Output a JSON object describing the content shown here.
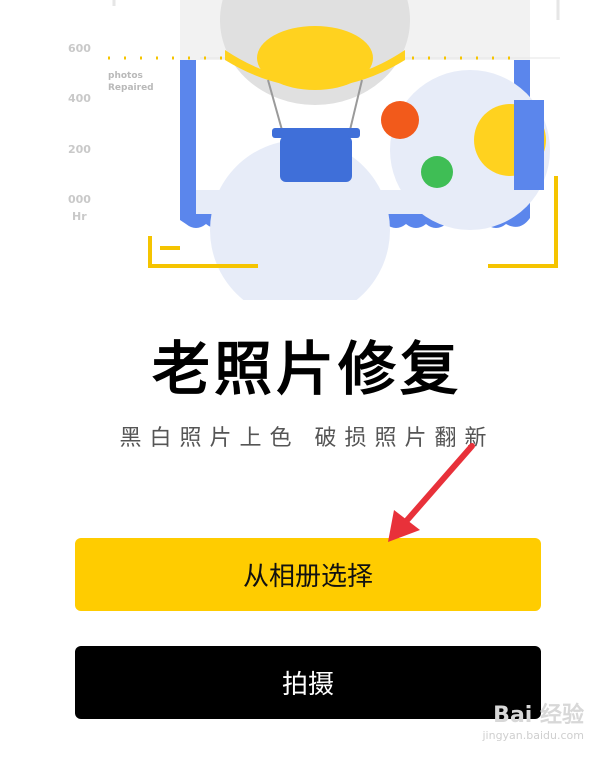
{
  "illustration": {
    "axis_labels": [
      "600",
      "400",
      "200",
      "000",
      "Hr"
    ],
    "caption": [
      "photos",
      "Repaired"
    ]
  },
  "title": "老照片修复",
  "subtitle": "黑白照片上色 破损照片翻新",
  "buttons": {
    "album_label": "从相册选择",
    "shoot_label": "拍摄"
  },
  "watermark": {
    "main": "Bai 经验",
    "sub": "jingyan.baidu.com"
  },
  "colors": {
    "accent_yellow": "#ffcc00",
    "stamp_blue": "#5b86ec",
    "button_black": "#000000",
    "arrow_red": "#e8313a"
  }
}
